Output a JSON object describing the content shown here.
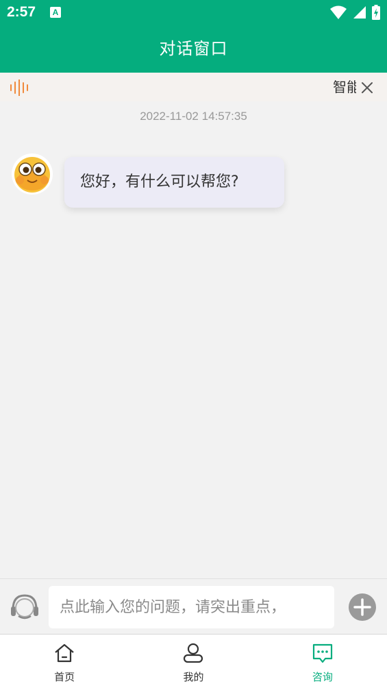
{
  "status_bar": {
    "time": "2:57",
    "notification_icon": "A"
  },
  "header": {
    "title": "对话窗口"
  },
  "notice": {
    "text": "智能"
  },
  "chat": {
    "timestamp": "2022-11-02 14:57:35",
    "messages": [
      {
        "sender": "bot",
        "text": "您好，有什么可以帮您?"
      }
    ]
  },
  "input": {
    "placeholder": "点此输入您的问题，请突出重点，"
  },
  "tabs": [
    {
      "label": "首页",
      "icon": "home-icon",
      "active": false
    },
    {
      "label": "我的",
      "icon": "user-icon",
      "active": false
    },
    {
      "label": "咨询",
      "icon": "chat-icon",
      "active": true
    }
  ],
  "colors": {
    "primary": "#05ad7e",
    "notice_bg": "#f5f2ef",
    "bubble_bg": "#ecebf6",
    "wave": "#f08a3c"
  }
}
